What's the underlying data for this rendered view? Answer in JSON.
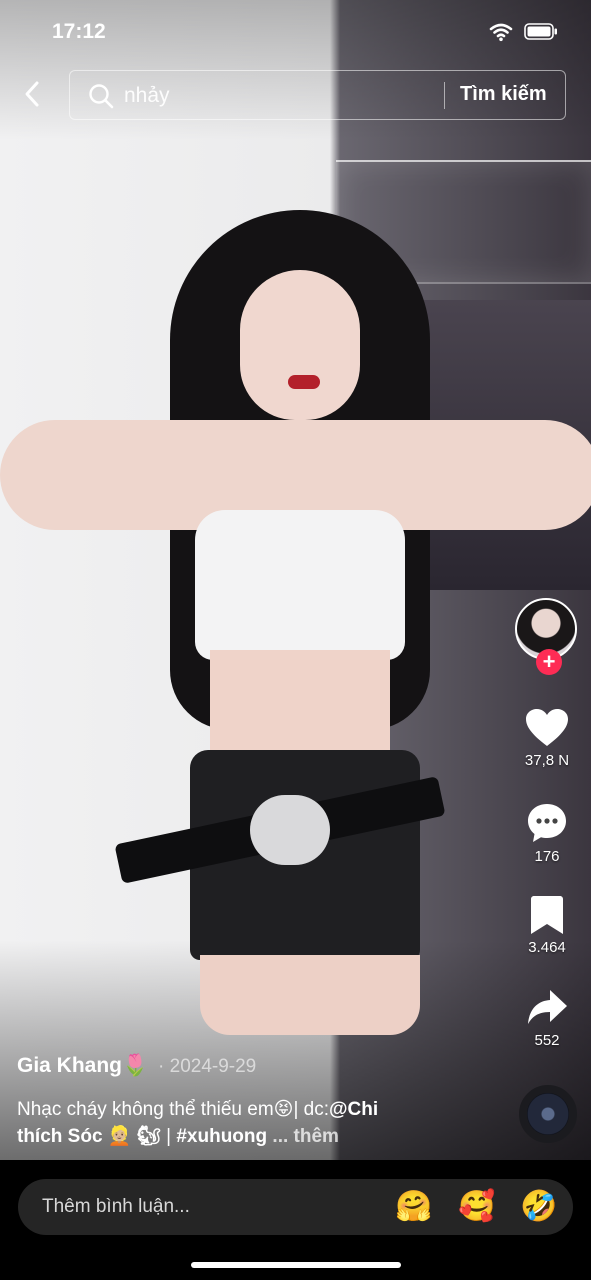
{
  "status_bar": {
    "time": "17:12"
  },
  "search": {
    "query": "nhảy",
    "submit_label": "Tìm kiếm"
  },
  "actions": {
    "like_count": "37,8 N",
    "comment_count": "176",
    "save_count": "3.464",
    "share_count": "552"
  },
  "post": {
    "author": "Gia Khang🌷",
    "separator": "·",
    "date": "2024-9-29",
    "caption_line1": "Nhạc cháy không thể thiếu em😝| dc:",
    "caption_mention": "@Chi",
    "caption_line2_bold": "thích Sóc 👱🏼 🐿",
    "caption_sep": " | ",
    "caption_hashtag": "#xuhuong",
    "caption_more": "... thêm"
  },
  "comment_bar": {
    "placeholder": "Thêm bình luận...",
    "emojis": [
      "🤗",
      "🥰",
      "🤣"
    ]
  },
  "colors": {
    "follow": "#fe2c55",
    "comment_box": "#252525"
  }
}
